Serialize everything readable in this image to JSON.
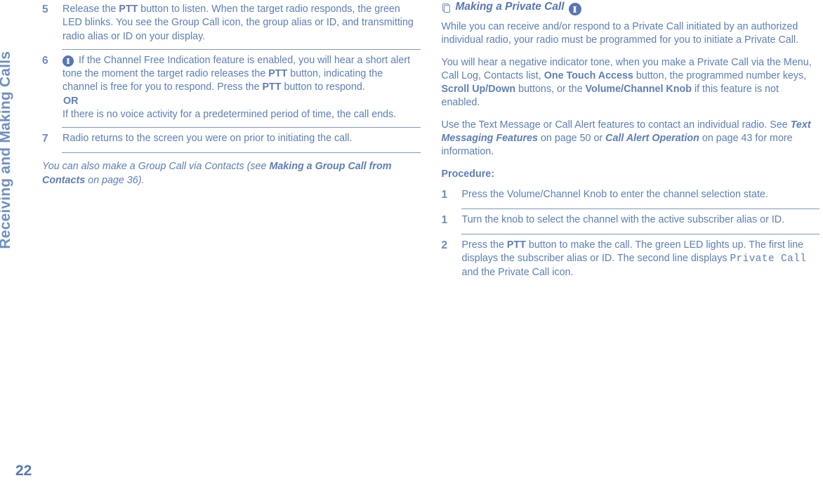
{
  "sidebar": {
    "section_title": "Receiving and Making Calls"
  },
  "page_number": "22",
  "left": {
    "steps": [
      {
        "num": "5",
        "pre": "Release the ",
        "b1": "PTT",
        "post": " button to listen. When the target radio responds, the green LED blinks. You see the Group Call icon, the group alias or ID, and transmitting radio alias or ID on your display."
      },
      {
        "num": "6",
        "p1a": " If the Channel Free Indication feature is enabled, you will hear a short alert tone the moment the target radio releases the ",
        "p1b": "PTT",
        "p1c": " button, indicating the channel is free for you to respond. Press the ",
        "p1d": "PTT",
        "p1e": " button to respond.",
        "or": "OR",
        "p2": "If there is no voice activity for a predetermined period of time, the call ends."
      },
      {
        "num": "7",
        "text": "Radio returns to the screen you were on prior to initiating the call."
      }
    ],
    "note_a": "You can also make a Group Call via Contacts (see ",
    "note_b": "Making a Group Call from Contacts",
    "note_c": " on page 36)."
  },
  "right": {
    "heading": "Making a Private Call",
    "p1": "While you can receive and/or respond to a Private Call initiated by an authorized individual radio, your radio must be programmed for you to initiate a Private Call.",
    "p2a": "You will hear a negative indicator tone, when you make a Private Call via the Menu, Call Log, Contacts list, ",
    "p2b": "One Touch Access",
    "p2c": " button, the programmed number keys, ",
    "p2d": "Scroll Up/Down",
    "p2e": " buttons, or the ",
    "p2f": "Volume/Channel Knob",
    "p2g": " if this feature is not enabled.",
    "p3a": "Use the Text Message or Call Alert features to contact an individual radio. See ",
    "p3b": "Text Messaging Features",
    "p3c": " on page 50 or ",
    "p3d": "Call Alert Operation",
    "p3e": " on page 43 for more information.",
    "proc_label": "Procedure:",
    "steps": [
      {
        "num": "1",
        "text": "Press the Volume/Channel Knob to enter the channel selection state."
      },
      {
        "num": "1",
        "text": "Turn the knob to select the channel with the active subscriber alias or ID."
      },
      {
        "num": "2",
        "a": "Press the ",
        "b": "PTT",
        "c": " button to make the call. The green LED lights up. The first line displays the subscriber alias or ID. The second line displays ",
        "d": "Private Call",
        "e": " and the Private Call icon."
      }
    ]
  }
}
